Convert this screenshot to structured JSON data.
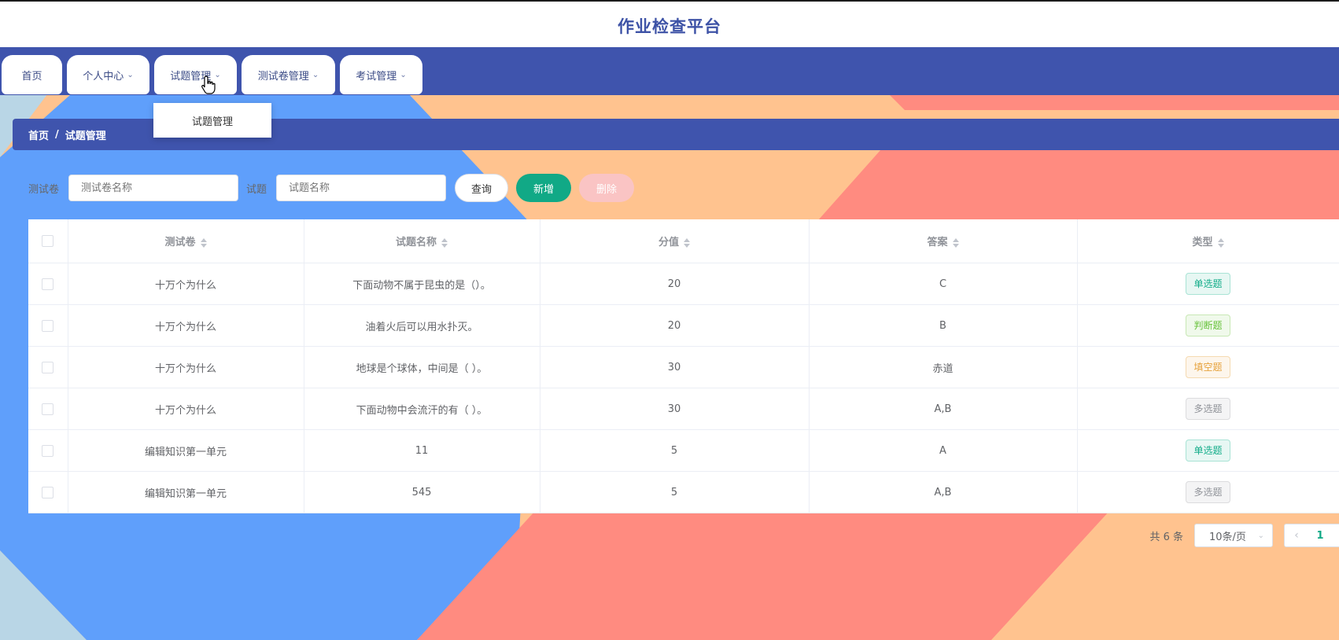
{
  "site": {
    "title": "作业检查平台"
  },
  "nav": {
    "tabs": [
      {
        "label": "首页",
        "has_dropdown": false
      },
      {
        "label": "个人中心",
        "has_dropdown": true
      },
      {
        "label": "试题管理",
        "has_dropdown": true
      },
      {
        "label": "测试卷管理",
        "has_dropdown": true
      },
      {
        "label": "考试管理",
        "has_dropdown": true
      }
    ],
    "dropdown_item": "试题管理"
  },
  "breadcrumb": {
    "home": "首页",
    "separator": "/",
    "current": "试题管理"
  },
  "filters": {
    "paper_label": "测试卷",
    "paper_placeholder": "测试卷名称",
    "question_label": "试题",
    "question_placeholder": "试题名称",
    "query_button": "查询",
    "add_button": "新增",
    "delete_button": "删除"
  },
  "table": {
    "headers": [
      "测试卷",
      "试题名称",
      "分值",
      "答案",
      "类型"
    ],
    "rows": [
      {
        "paper": "十万个为什么",
        "question": "下面动物不属于昆虫的是（）。",
        "score": "20",
        "answer": "C",
        "type": "单选题"
      },
      {
        "paper": "十万个为什么",
        "question": "油着火后可以用水扑灭。",
        "score": "20",
        "answer": "B",
        "type": "判断题"
      },
      {
        "paper": "十万个为什么",
        "question": "地球是个球体，中间是（ ）。",
        "score": "30",
        "answer": "赤道",
        "type": "填空题"
      },
      {
        "paper": "十万个为什么",
        "question": "下面动物中会流汗的有（ ）。",
        "score": "30",
        "answer": "A,B",
        "type": "多选题"
      },
      {
        "paper": "编辑知识第一单元",
        "question": "11",
        "score": "5",
        "answer": "A",
        "type": "单选题"
      },
      {
        "paper": "编辑知识第一单元",
        "question": "545",
        "score": "5",
        "answer": "A,B",
        "type": "多选题"
      }
    ]
  },
  "type_colors": {
    "单选题": {
      "bg": "#e7f7f3",
      "border": "#a9e3d5",
      "text": "#13ad8a"
    },
    "判断题": {
      "bg": "#f0f9eb",
      "border": "#c8e8b5",
      "text": "#67c23a"
    },
    "填空题": {
      "bg": "#fdf6ec",
      "border": "#f5dab1",
      "text": "#e6a23c"
    },
    "多选题": {
      "bg": "#f4f4f5",
      "border": "#dcdcde",
      "text": "#909399"
    }
  },
  "pagination": {
    "total_text": "共 6 条",
    "page_size": "10条/页",
    "current_page": "1"
  },
  "theme": {
    "primary": "#3f54ad",
    "accent": "#11a986",
    "danger_light": "#fac4c4"
  }
}
